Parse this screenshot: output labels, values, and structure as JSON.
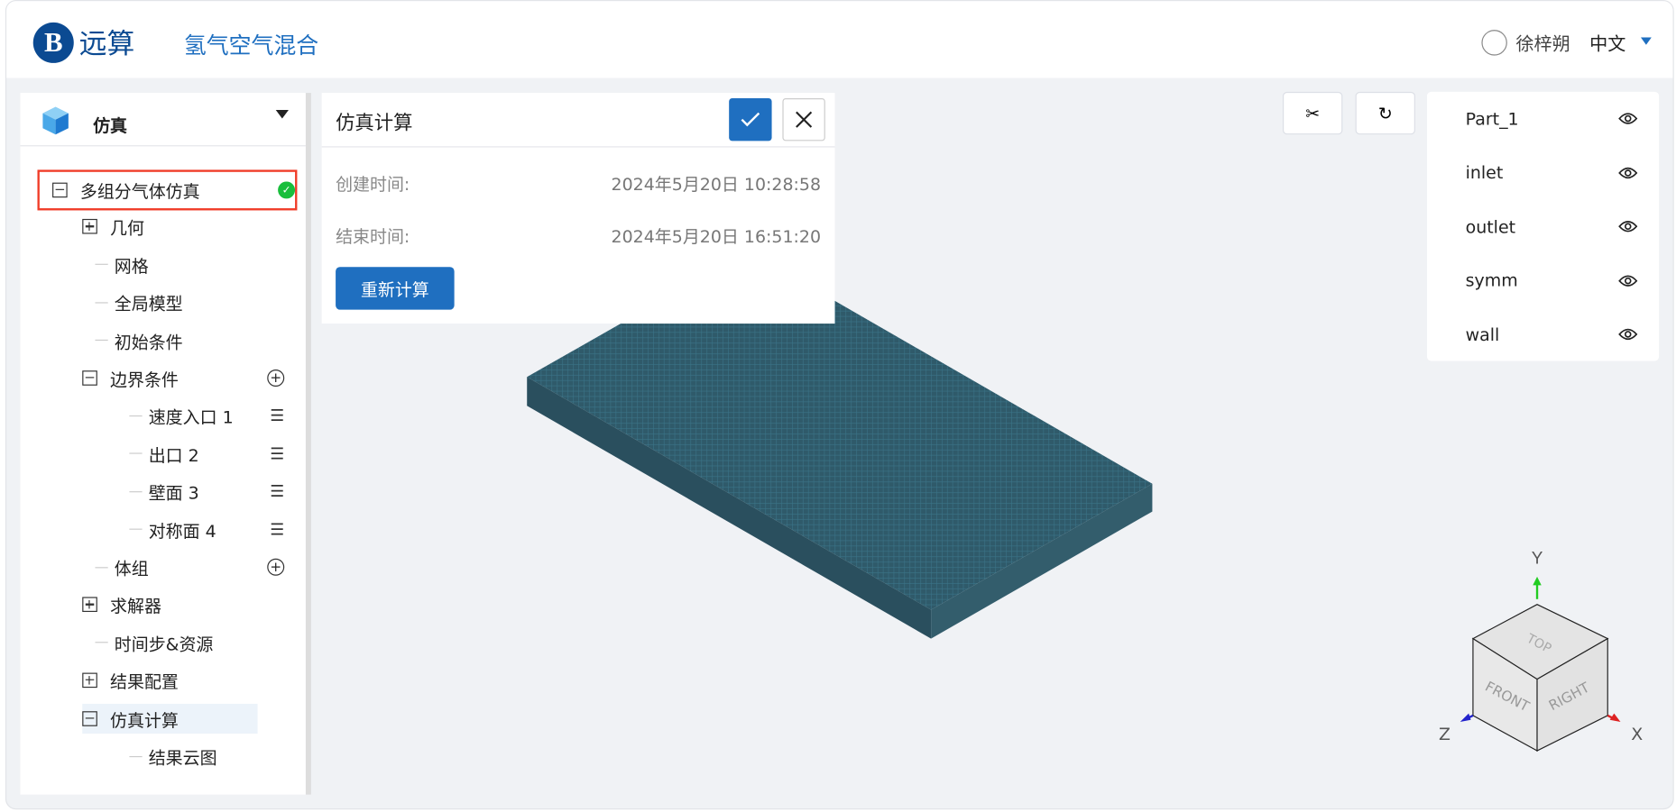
{
  "header": {
    "logo_letter": "B",
    "logo_text": "远算",
    "app_title": "氢气空气混合",
    "user_name": "徐梓朔",
    "language": "中文"
  },
  "left_panel": {
    "module": "仿真",
    "tree": [
      {
        "label": "多组分气体仿真",
        "toggle": "minus",
        "status": "success"
      },
      {
        "label": "几何",
        "toggle": "plus"
      },
      {
        "label": "网格"
      },
      {
        "label": "全局模型"
      },
      {
        "label": "初始条件"
      },
      {
        "label": "边界条件",
        "toggle": "minus",
        "action": "add"
      },
      {
        "label": "速度入口 1",
        "action": "list"
      },
      {
        "label": "出口 2",
        "action": "list"
      },
      {
        "label": "壁面 3",
        "action": "list"
      },
      {
        "label": "对称面 4",
        "action": "list"
      },
      {
        "label": "体组",
        "action": "add"
      },
      {
        "label": "求解器",
        "toggle": "plus"
      },
      {
        "label": "时间步&资源"
      },
      {
        "label": "结果配置",
        "toggle": "plus"
      },
      {
        "label": "仿真计算",
        "toggle": "minus",
        "selected": true
      },
      {
        "label": "结果云图"
      }
    ]
  },
  "dialog": {
    "title": "仿真计算",
    "created_label": "创建时间:",
    "created_value": "2024年5月20日 10:28:58",
    "ended_label": "结束时间:",
    "ended_value": "2024年5月20日 16:51:20",
    "recalc_label": "重新计算"
  },
  "parts": [
    "Part_1",
    "inlet",
    "outlet",
    "symm",
    "wall"
  ],
  "view_cube": {
    "faces": [
      "TOP",
      "FRONT",
      "RIGHT"
    ],
    "axes": [
      "X",
      "Y",
      "Z"
    ]
  },
  "colors": {
    "accent": "#1f6fc0",
    "success": "#19be3c",
    "highlight": "#f03c28",
    "mesh": "#2f5a6a"
  }
}
